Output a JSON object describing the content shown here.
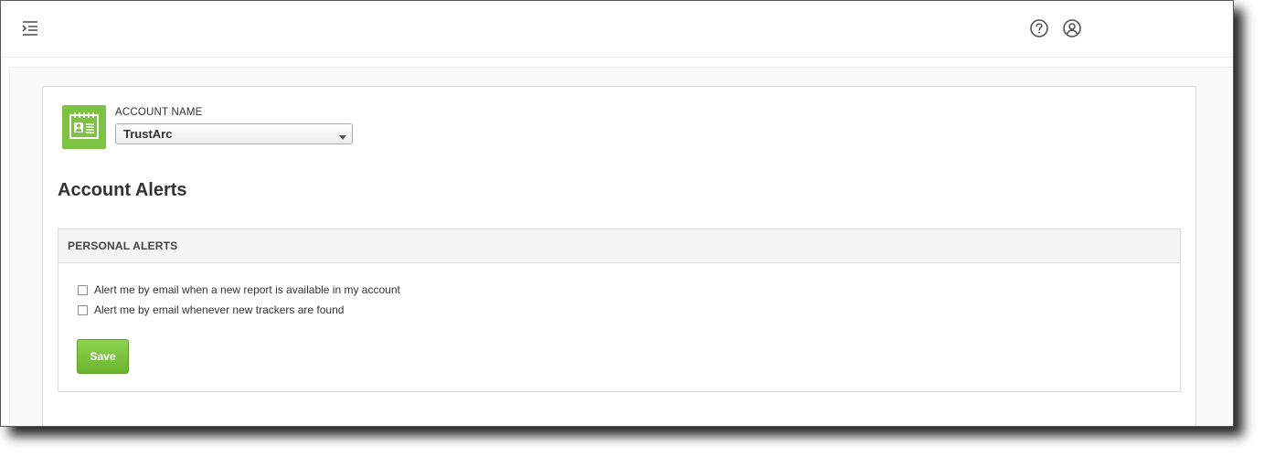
{
  "header": {
    "menu_icon": "menu-collapse-icon",
    "help_icon": "help-circle-icon",
    "user_icon": "user-circle-icon"
  },
  "account": {
    "label": "ACCOUNT NAME",
    "selected": "TrustArc",
    "icon": "id-card-icon",
    "icon_color": "#7dc243"
  },
  "page": {
    "title": "Account Alerts"
  },
  "personal_alerts": {
    "heading": "PERSONAL ALERTS",
    "options": [
      {
        "label": "Alert me by email when a new report is available in my account",
        "checked": false
      },
      {
        "label": "Alert me by email whenever new trackers are found",
        "checked": false
      }
    ],
    "save_label": "Save",
    "save_color": "#7dc243"
  }
}
